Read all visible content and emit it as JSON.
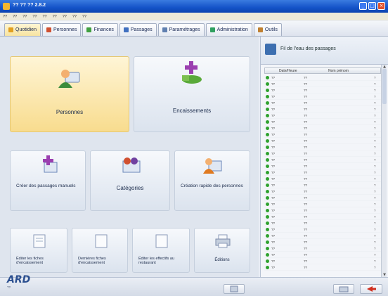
{
  "window": {
    "title": "?? ?? ?? 2.8.2"
  },
  "menu": [
    "??",
    "??",
    "??",
    "??",
    "??",
    "??",
    "??",
    "??",
    "??"
  ],
  "tabs": [
    {
      "label": "Quotidien",
      "icon": "home-icon",
      "color": "#e2a020",
      "active": true
    },
    {
      "label": "Personnes",
      "icon": "person-icon",
      "color": "#d05030",
      "active": false
    },
    {
      "label": "Finances",
      "icon": "money-icon",
      "color": "#40a040",
      "active": false
    },
    {
      "label": "Passages",
      "icon": "arrow-icon",
      "color": "#4070c0",
      "active": false
    },
    {
      "label": "Paramétrages",
      "icon": "settings-icon",
      "color": "#6080b0",
      "active": false
    },
    {
      "label": "Administration",
      "icon": "admin-icon",
      "color": "#30a060",
      "active": false
    },
    {
      "label": "Outils",
      "icon": "tools-icon",
      "color": "#c08030",
      "active": false
    }
  ],
  "tiles": {
    "personnes": "Personnes",
    "encaissements": "Encaissements",
    "creer_passages": "Créer des passages manuels",
    "categories": "Catégories",
    "creation_rapide": "Création rapide des personnes",
    "editer_fiches": "Éditer les fiches d'encaissement",
    "derniere_fiches": "Dernières fiches d'encaissement",
    "editer_effectifs": "Éditer les effectifs au restaurant",
    "editions": "Éditions"
  },
  "panel": {
    "title": "Fil de l'eau des passages",
    "col_date": "Date/Heure",
    "col_name": "Nom prénom"
  },
  "rows": [
    {
      "dt": "??",
      "name": "??",
      "ch": "?"
    },
    {
      "dt": "??",
      "name": "??",
      "ch": "?"
    },
    {
      "dt": "??",
      "name": "??",
      "ch": "?"
    },
    {
      "dt": "??",
      "name": "??",
      "ch": "?"
    },
    {
      "dt": "??",
      "name": "??",
      "ch": "?"
    },
    {
      "dt": "??",
      "name": "??",
      "ch": "?"
    },
    {
      "dt": "??",
      "name": "??",
      "ch": "?"
    },
    {
      "dt": "??",
      "name": "??",
      "ch": "?"
    },
    {
      "dt": "??",
      "name": "??",
      "ch": "?"
    },
    {
      "dt": "??",
      "name": "??",
      "ch": "?"
    },
    {
      "dt": "??",
      "name": "??",
      "ch": "?"
    },
    {
      "dt": "??",
      "name": "??",
      "ch": "?"
    },
    {
      "dt": "??",
      "name": "??",
      "ch": "?"
    },
    {
      "dt": "??",
      "name": "??",
      "ch": "?"
    },
    {
      "dt": "??",
      "name": "??",
      "ch": "?"
    },
    {
      "dt": "??",
      "name": "??",
      "ch": "?"
    },
    {
      "dt": "??",
      "name": "??",
      "ch": "?"
    },
    {
      "dt": "??",
      "name": "??",
      "ch": "?"
    },
    {
      "dt": "??",
      "name": "??",
      "ch": "?"
    },
    {
      "dt": "??",
      "name": "??",
      "ch": "?"
    },
    {
      "dt": "??",
      "name": "??",
      "ch": "?"
    },
    {
      "dt": "??",
      "name": "??",
      "ch": "?"
    },
    {
      "dt": "??",
      "name": "??",
      "ch": "?"
    },
    {
      "dt": "??",
      "name": "??",
      "ch": "?"
    },
    {
      "dt": "??",
      "name": "??",
      "ch": "?"
    },
    {
      "dt": "??",
      "name": "??",
      "ch": "?"
    },
    {
      "dt": "??",
      "name": "??",
      "ch": "?"
    },
    {
      "dt": "??",
      "name": "??",
      "ch": "?"
    },
    {
      "dt": "??",
      "name": "??",
      "ch": "?"
    },
    {
      "dt": "??",
      "name": "??",
      "ch": "?"
    },
    {
      "dt": "??",
      "name": "??",
      "ch": "?"
    }
  ],
  "logo": {
    "text": "ARD",
    "sub": "??"
  },
  "status_color_ok": "#2fa22f",
  "accent_active": "#f8dc8e"
}
